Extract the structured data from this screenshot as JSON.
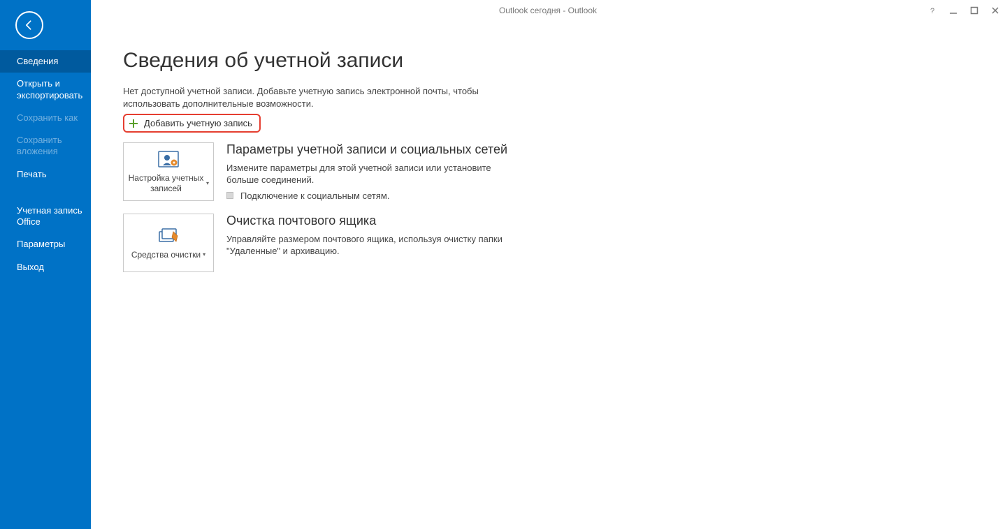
{
  "window": {
    "title": "Outlook сегодня - Outlook"
  },
  "sidebar": {
    "items": [
      {
        "label": "Сведения",
        "state": "selected"
      },
      {
        "label": "Открыть и экспортировать",
        "state": "normal"
      },
      {
        "label": "Сохранить как",
        "state": "disabled"
      },
      {
        "label": "Сохранить вложения",
        "state": "disabled"
      },
      {
        "label": "Печать",
        "state": "normal"
      }
    ],
    "bottom_items": [
      {
        "label": "Учетная запись Office",
        "state": "normal"
      },
      {
        "label": "Параметры",
        "state": "normal"
      },
      {
        "label": "Выход",
        "state": "normal"
      }
    ]
  },
  "main": {
    "page_title": "Сведения об учетной записи",
    "info_text": "Нет доступной учетной записи. Добавьте учетную запись электронной почты, чтобы использовать дополнительные возможности.",
    "add_account_label": "Добавить учетную запись",
    "sections": [
      {
        "button_label": "Настройка учетных записей",
        "title": "Параметры учетной записи и социальных сетей",
        "desc": "Измените параметры для этой учетной записи или установите больше соединений.",
        "bullet": "Подключение к социальным сетям."
      },
      {
        "button_label": "Средства очистки",
        "title": "Очистка почтового ящика",
        "desc": "Управляйте размером почтового ящика, используя очистку папки \"Удаленные\" и архивацию."
      }
    ]
  }
}
